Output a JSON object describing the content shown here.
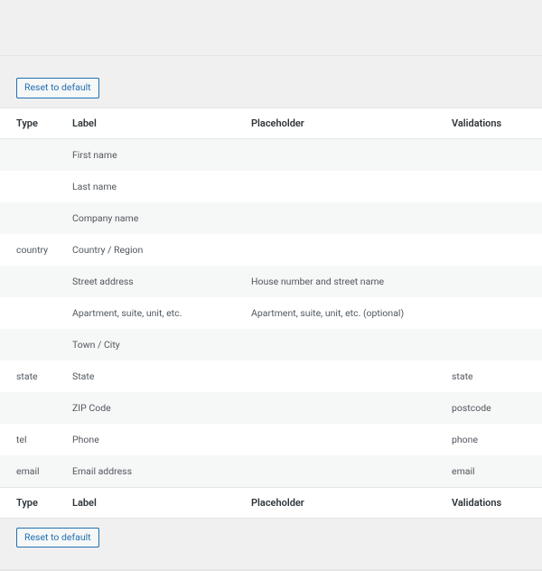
{
  "buttons": {
    "reset": "Reset to default"
  },
  "headers": {
    "type": "Type",
    "label": "Label",
    "placeholder": "Placeholder",
    "validations": "Validations"
  },
  "rows": [
    {
      "type": "",
      "label": "First name",
      "placeholder": "",
      "validations": ""
    },
    {
      "type": "",
      "label": "Last name",
      "placeholder": "",
      "validations": ""
    },
    {
      "type": "",
      "label": "Company name",
      "placeholder": "",
      "validations": ""
    },
    {
      "type": "country",
      "label": "Country / Region",
      "placeholder": "",
      "validations": ""
    },
    {
      "type": "",
      "label": "Street address",
      "placeholder": "House number and street name",
      "validations": ""
    },
    {
      "type": "",
      "label": "Apartment, suite, unit, etc.",
      "placeholder": "Apartment, suite, unit, etc. (optional)",
      "validations": ""
    },
    {
      "type": "",
      "label": "Town / City",
      "placeholder": "",
      "validations": ""
    },
    {
      "type": "state",
      "label": "State",
      "placeholder": "",
      "validations": "state"
    },
    {
      "type": "",
      "label": "ZIP Code",
      "placeholder": "",
      "validations": "postcode"
    },
    {
      "type": "tel",
      "label": "Phone",
      "placeholder": "",
      "validations": "phone"
    },
    {
      "type": "email",
      "label": "Email address",
      "placeholder": "",
      "validations": "email"
    }
  ]
}
